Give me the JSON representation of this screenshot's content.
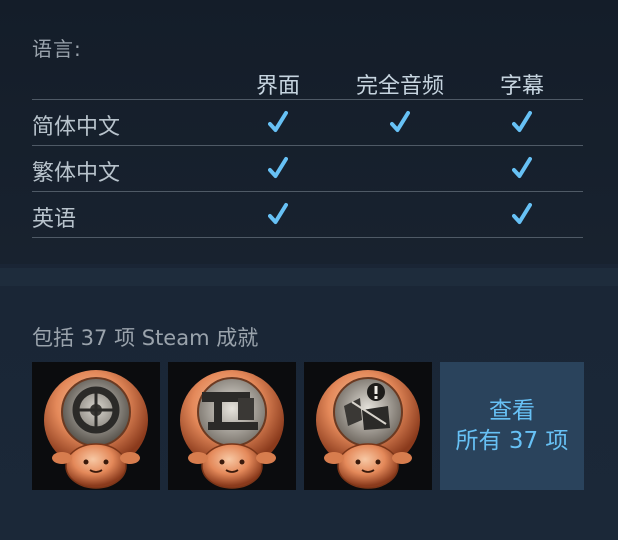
{
  "languages": {
    "title": "语言:",
    "columns": [
      "界面",
      "完全音频",
      "字幕"
    ],
    "rows": [
      {
        "name": "简体中文",
        "interface": true,
        "full_audio": true,
        "subtitles": true
      },
      {
        "name": "繁体中文",
        "interface": true,
        "full_audio": false,
        "subtitles": true
      },
      {
        "name": "英语",
        "interface": true,
        "full_audio": false,
        "subtitles": true
      }
    ],
    "check_color": "#67c1f5"
  },
  "achievements": {
    "title": "包括 37 项 Steam 成就",
    "icons": [
      {
        "name": "achievement-wheel-icon"
      },
      {
        "name": "achievement-machine-icon"
      },
      {
        "name": "achievement-alert-icon"
      }
    ],
    "view_all_line1": "查看",
    "view_all_line2": "所有 37 项",
    "accent_color": "#67c1f5",
    "tile_bg": "#2a435c"
  }
}
